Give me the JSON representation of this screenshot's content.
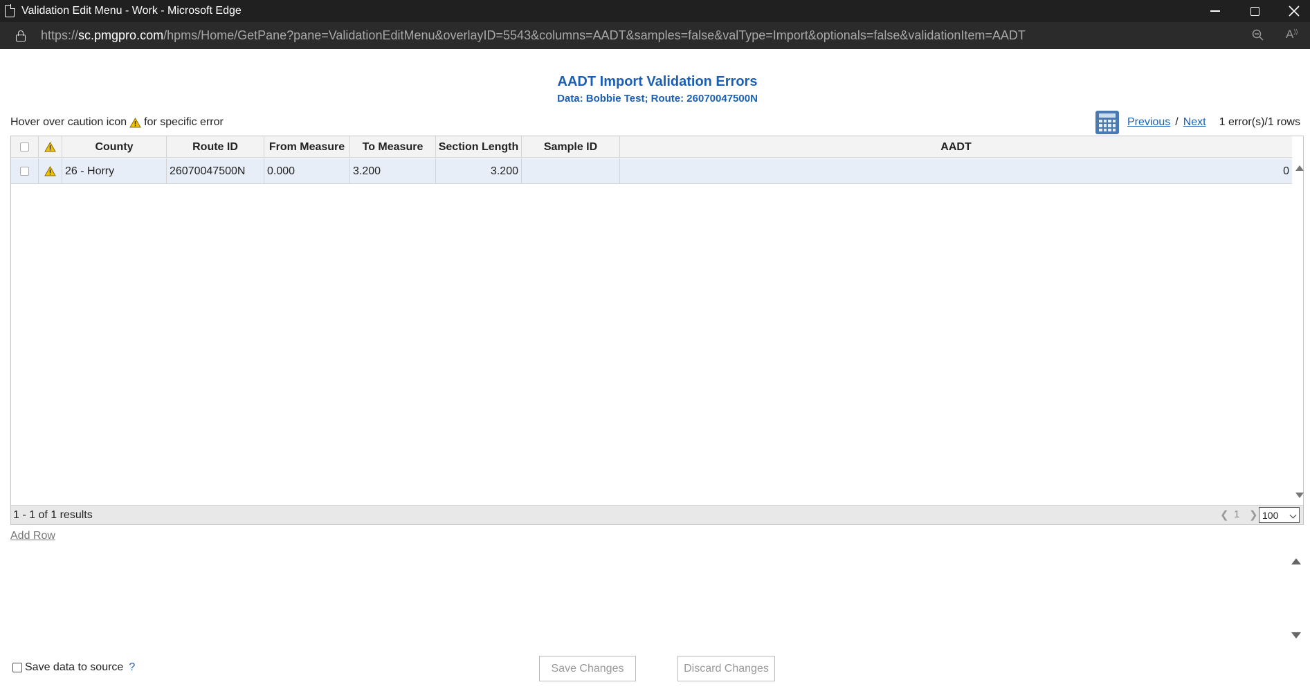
{
  "window": {
    "title": "Validation Edit Menu - Work - Microsoft Edge"
  },
  "address": {
    "prefix": "https://",
    "host": "sc.pmgpro.com",
    "path": "/hpms/Home/GetPane?pane=ValidationEditMenu&overlayID=5543&columns=AADT&samples=false&valType=Import&optionals=false&validationItem=AADT"
  },
  "page": {
    "title": "AADT Import Validation Errors",
    "subtitle": "Data: Bobbie Test; Route: 26070047500N",
    "hint_before": "Hover over caution icon",
    "hint_after": "for specific error"
  },
  "nav": {
    "previous": "Previous",
    "separator": "/",
    "next": "Next",
    "error_count": "1 error(s)/1 rows"
  },
  "grid": {
    "columns": [
      "County",
      "Route ID",
      "From Measure",
      "To Measure",
      "Section Length",
      "Sample ID",
      "AADT"
    ],
    "rows": [
      {
        "county": "26 - Horry",
        "route_id": "26070047500N",
        "from_measure": "0.000",
        "to_measure": "3.200",
        "section_length": "3.200",
        "sample_id": "",
        "aadt": "0"
      }
    ],
    "pager": {
      "results": "1 - 1 of 1 results",
      "page": "1",
      "page_size": "100"
    }
  },
  "actions": {
    "add_row": "Add Row",
    "save_to_source": "Save data to source",
    "help": "?",
    "save_changes": "Save Changes",
    "discard_changes": "Discard Changes"
  },
  "colors": {
    "accent": "#1a5fb4",
    "warning": "#f2c200",
    "row_highlight": "#e7eef8"
  }
}
